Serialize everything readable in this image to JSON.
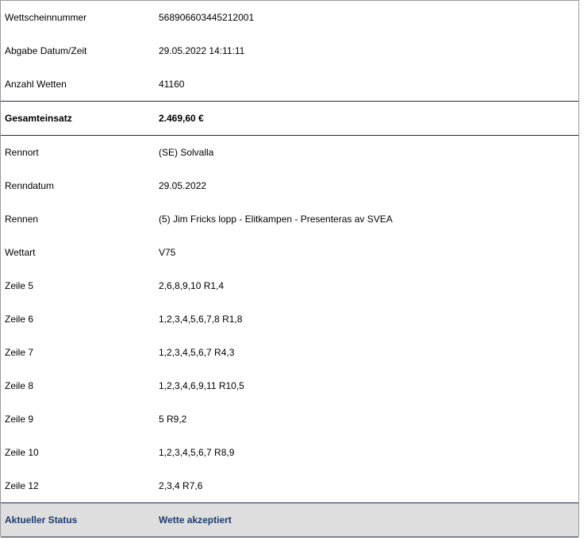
{
  "ticket": {
    "header_rows": [
      {
        "label": "Wettscheinnummer",
        "value": "568906603445212001"
      },
      {
        "label": "Abgabe Datum/Zeit",
        "value": "29.05.2022 14:11:11"
      },
      {
        "label": "Anzahl Wetten",
        "value": "41160"
      }
    ],
    "total": {
      "label": "Gesamteinsatz",
      "value": "2.469,60 €"
    },
    "detail_rows": [
      {
        "label": "Rennort",
        "value": "(SE) Solvalla"
      },
      {
        "label": "Renndatum",
        "value": "29.05.2022"
      },
      {
        "label": "Rennen",
        "value": "(5) Jim Fricks lopp - Elitkampen - Presenteras av SVEA"
      },
      {
        "label": "Wettart",
        "value": "V75"
      },
      {
        "label": "Zeile 5",
        "value": "2,6,8,9,10 R1,4"
      },
      {
        "label": "Zeile 6",
        "value": "1,2,3,4,5,6,7,8 R1,8"
      },
      {
        "label": "Zeile 7",
        "value": "1,2,3,4,5,6,7 R4,3"
      },
      {
        "label": "Zeile 8",
        "value": "1,2,3,4,6,9,11 R10,5"
      },
      {
        "label": "Zeile 9",
        "value": "5 R9,2"
      },
      {
        "label": "Zeile 10",
        "value": "1,2,3,4,5,6,7 R8,9"
      },
      {
        "label": "Zeile 12",
        "value": "2,3,4 R7,6"
      }
    ],
    "status": {
      "label": "Aktueller Status",
      "value": "Wette akzeptiert"
    }
  },
  "colors": {
    "status_text": "#1e3a6e",
    "status_background": "#dedede",
    "divider": "#1b2a4a"
  }
}
